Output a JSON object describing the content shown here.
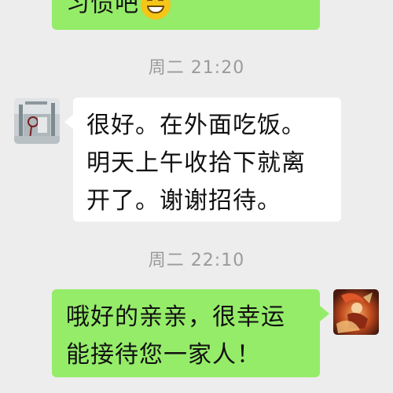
{
  "messages": [
    {
      "text_partial": "习惯吧"
    },
    {
      "timestamp": "周二 21:20"
    },
    {
      "text": "很好。在外面吃饭。明天上午收拾下就离开了。谢谢招待。",
      "line1": "很好。在外面吃饭。",
      "line2": "明天上午收拾下就离",
      "line3": "开了。谢谢招待。"
    },
    {
      "timestamp": "周二 22:10"
    },
    {
      "text": "哦好的亲亲，很幸运能接待您一家人！",
      "line1": "哦好的亲亲，很幸运",
      "line2": "能接待您一家人！"
    }
  ],
  "icons": {
    "emoji": "grinning-face-icon",
    "avatar_left": "guest-avatar",
    "avatar_right": "host-avatar"
  },
  "colors": {
    "background": "#ededed",
    "outgoing_bubble": "#95ec69",
    "incoming_bubble": "#ffffff",
    "timestamp_text": "#9b9b9b"
  }
}
